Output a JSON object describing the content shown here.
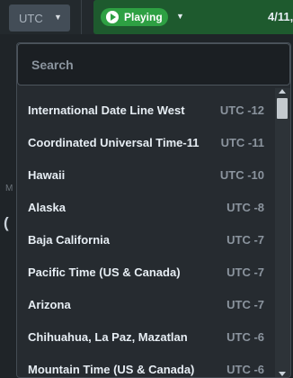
{
  "topbar": {
    "timezone_label": "UTC",
    "status_label": "Playing",
    "date_fragment": "4/11,"
  },
  "background": {
    "fragment1": "M",
    "fragment2": "("
  },
  "dropdown": {
    "search_placeholder": "Search",
    "items": [
      {
        "name": "International Date Line West",
        "offset": "UTC -12"
      },
      {
        "name": "Coordinated Universal Time-11",
        "offset": "UTC -11"
      },
      {
        "name": "Hawaii",
        "offset": "UTC -10"
      },
      {
        "name": "Alaska",
        "offset": "UTC -8"
      },
      {
        "name": "Baja California",
        "offset": "UTC -7"
      },
      {
        "name": "Pacific Time (US & Canada)",
        "offset": "UTC -7"
      },
      {
        "name": "Arizona",
        "offset": "UTC -7"
      },
      {
        "name": "Chihuahua, La Paz, Mazatlan",
        "offset": "UTC -6"
      },
      {
        "name": "Mountain Time (US & Canada)",
        "offset": "UTC -6"
      }
    ]
  }
}
